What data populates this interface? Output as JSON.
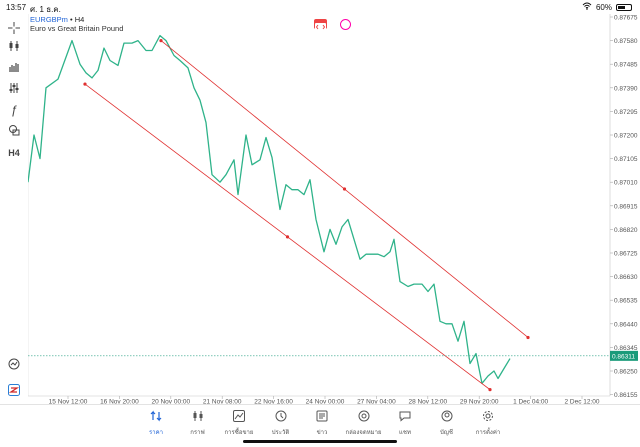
{
  "status_bar": {
    "time": "13:57",
    "date": "ศ. 1 ธ.ค.",
    "battery": "60%",
    "battery_level": 0.6
  },
  "chart": {
    "symbol": "EURGBPm",
    "timeframe_prefix": " • ",
    "timeframe": "H4",
    "description": "Euro vs Great Britain Pound",
    "current_price": "0.86311",
    "colors": {
      "line": "#2fb38a",
      "channel": "#e03030",
      "price_tag": "#1a9b7a",
      "price_line": "#2aa184",
      "symbol": "#1f63d6"
    },
    "y_ticks": [
      "0.87675",
      "0.87580",
      "0.87485",
      "0.87390",
      "0.87295",
      "0.87200",
      "0.87105",
      "0.87010",
      "0.86915",
      "0.86820",
      "0.86725",
      "0.86630",
      "0.86535",
      "0.86440",
      "0.86345",
      "0.86250",
      "0.86155"
    ],
    "x_ticks": [
      "15 Nov 12:00",
      "16 Nov 20:00",
      "20 Nov 00:00",
      "21 Nov 08:00",
      "22 Nov 16:00",
      "24 Nov 00:00",
      "27 Nov 04:00",
      "28 Nov 12:00",
      "29 Nov 20:00",
      "1 Dec 04:00",
      "2 Dec 12:00"
    ]
  },
  "toolbar": {
    "tools": [
      {
        "name": "crosshair-icon",
        "glyph": "⌖"
      },
      {
        "name": "chart-type-icon",
        "glyph": "⫶"
      },
      {
        "name": "indicators-icon",
        "glyph": "▟"
      },
      {
        "name": "settings-sliders-icon",
        "glyph": "⫵"
      },
      {
        "name": "function-icon",
        "glyph": "ƒ"
      },
      {
        "name": "objects-icon",
        "glyph": "⟁"
      },
      {
        "name": "timeframe-label",
        "glyph": "H4"
      }
    ]
  },
  "bottom_nav": [
    {
      "key": "quotes",
      "label": "ราคา",
      "active": true
    },
    {
      "key": "chart",
      "label": "กราฟ"
    },
    {
      "key": "trade",
      "label": "การซื้อขาย"
    },
    {
      "key": "history",
      "label": "ประวัติ"
    },
    {
      "key": "news",
      "label": "ข่าว"
    },
    {
      "key": "mailbox",
      "label": "กล่องจดหมาย"
    },
    {
      "key": "chat",
      "label": "แชท"
    },
    {
      "key": "account",
      "label": "บัญชี"
    },
    {
      "key": "settings",
      "label": "การตั้งค่า"
    }
  ]
}
